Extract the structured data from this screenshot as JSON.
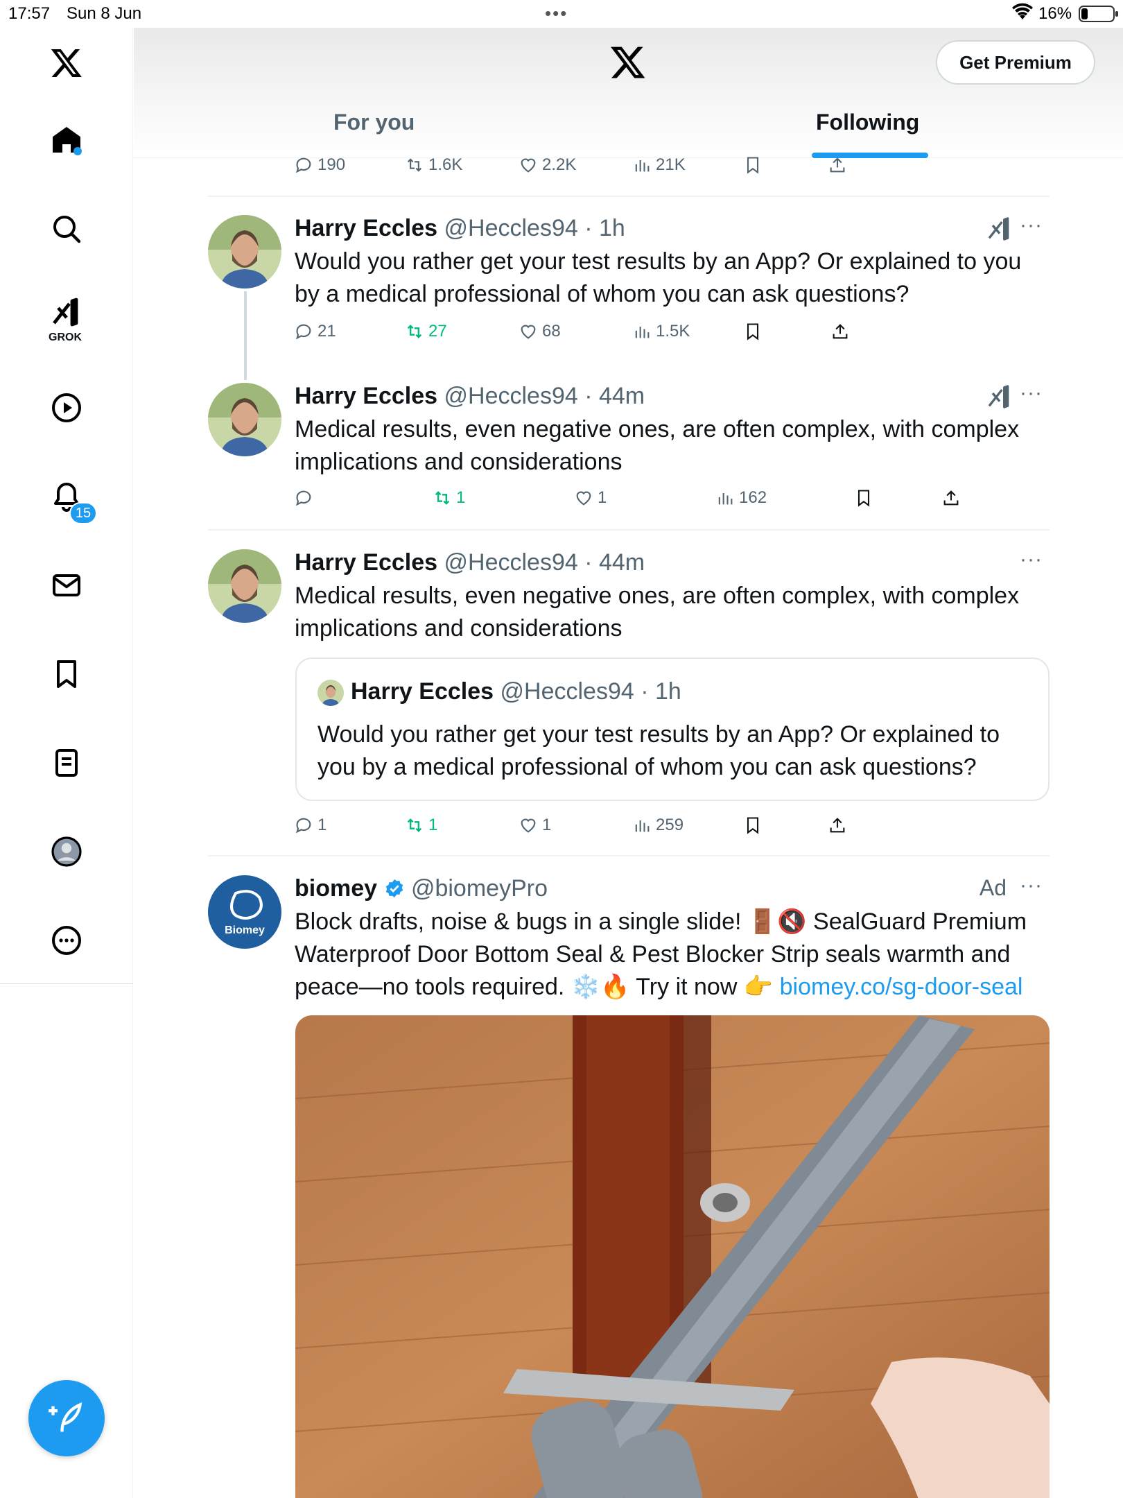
{
  "status_bar": {
    "time": "17:57",
    "date": "Sun 8 Jun",
    "battery": "16%",
    "dots": "•••"
  },
  "sidebar": {
    "grok_label": "GROK",
    "notification_count": "15",
    "items": [
      "home-icon",
      "search-icon",
      "grok-icon",
      "video-icon",
      "bell-icon",
      "mail-icon",
      "bookmark-icon",
      "lists-icon",
      "profile-icon",
      "more-icon"
    ]
  },
  "header": {
    "premium_button": "Get Premium",
    "tabs": [
      {
        "label": "For you",
        "active": false
      },
      {
        "label": "Following",
        "active": true
      }
    ]
  },
  "top_actions": {
    "replies": "190",
    "reposts": "1.6K",
    "likes": "2.2K",
    "views": "21K"
  },
  "tweets": [
    {
      "name": "Harry Eccles",
      "handle": "@Heccles94",
      "time": "· 1h",
      "text": "Would you rather get your test results by an App? Or explained to you by a medical professional of whom you can ask questions?",
      "replies": "21",
      "reposts": "27",
      "likes": "68",
      "views": "1.5K"
    },
    {
      "name": "Harry Eccles",
      "handle": "@Heccles94",
      "time": "· 44m",
      "text": "Medical results, even negative ones, are often complex, with complex implications and considerations",
      "replies": "",
      "reposts": "1",
      "likes": "1",
      "views": "162"
    },
    {
      "name": "Harry Eccles",
      "handle": "@Heccles94",
      "time": "· 44m",
      "text": "Medical results, even negative ones, are often complex, with complex implications and considerations",
      "quote": {
        "name": "Harry Eccles",
        "handle": "@Heccles94",
        "time": "· 1h",
        "text": "Would you rather get your test results by an App? Or explained to you by a medical professional of whom you can ask questions?"
      },
      "replies": "1",
      "reposts": "1",
      "likes": "1",
      "views": "259"
    },
    {
      "name": "biomey",
      "handle": "@biomeyPro",
      "ad_label": "Ad",
      "avatar_text": "Biomey",
      "text_main": "Block drafts, noise & bugs in a single slide! 🚪🔇 SealGuard Premium Waterproof Door Bottom Seal & Pest Blocker Strip seals warmth and peace—no tools required. ❄️🔥 Try it now 👉 ",
      "link": "biomey.co/sg-door-seal"
    }
  ],
  "colors": {
    "accent": "#1d9bf0",
    "repost": "#00ba7c",
    "muted": "#536471"
  }
}
